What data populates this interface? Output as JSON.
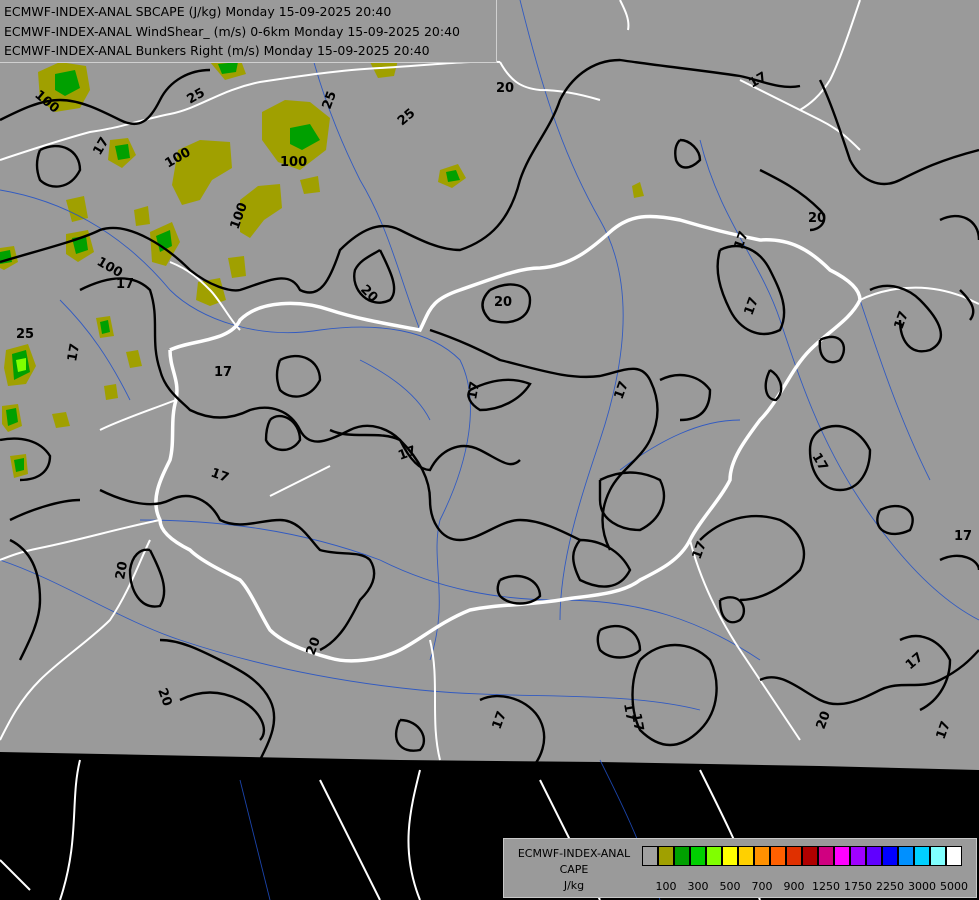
{
  "header": {
    "line1": "ECMWF-INDEX-ANAL SBCAPE (J/kg) Monday 15-09-2025 20:40",
    "line2": "ECMWF-INDEX-ANAL WindShear_ (m/s) 0-6km Monday 15-09-2025 20:40",
    "line3": "ECMWF-INDEX-ANAL Bunkers Right (m/s) Monday 15-09-2025 20:40"
  },
  "legend": {
    "title_line1": "ECMWF-INDEX-ANAL",
    "title_line2": "CAPE",
    "title_line3": "J/kg",
    "colors": [
      "#a0a0a0",
      "#a0a000",
      "#00a000",
      "#00d000",
      "#80ff00",
      "#ffff00",
      "#ffd000",
      "#ff9000",
      "#ff6000",
      "#e03000",
      "#b00000",
      "#d00080",
      "#ff00ff",
      "#a000ff",
      "#6000ff",
      "#0000ff",
      "#0090ff",
      "#00d0ff",
      "#80ffff",
      "#ffffff"
    ],
    "ticks": [
      "100",
      "300",
      "500",
      "700",
      "900",
      "1250",
      "1750",
      "2250",
      "3000",
      "5000"
    ]
  },
  "map": {
    "background_color": "#9a9a9a",
    "outside_color": "#000000",
    "contour_labels": [
      "25",
      "100",
      "25",
      "100",
      "100",
      "100",
      "17",
      "25",
      "25",
      "17",
      "17",
      "20",
      "20",
      "17",
      "17",
      "17",
      "20",
      "17",
      "17",
      "20",
      "17",
      "17",
      "20",
      "20",
      "17",
      "17",
      "17",
      "17",
      "17",
      "17",
      "17",
      "20",
      "20",
      "100",
      "17",
      "17",
      "17"
    ]
  }
}
